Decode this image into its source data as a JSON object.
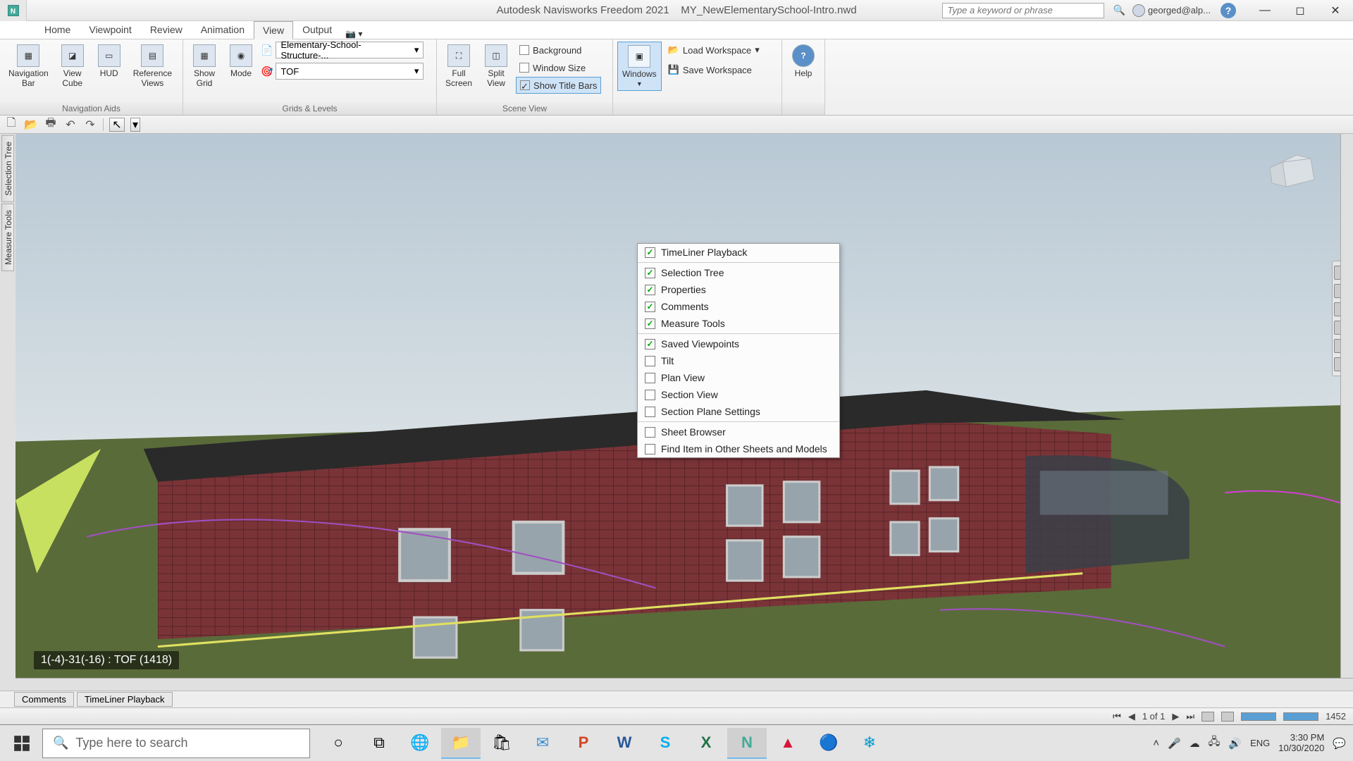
{
  "title": {
    "app": "Autodesk Navisworks Freedom 2021",
    "file": "MY_NewElementarySchool-Intro.nwd"
  },
  "search_placeholder": "Type a keyword or phrase",
  "user_label": "georged@alp...",
  "menu": {
    "tabs": [
      "Home",
      "Viewpoint",
      "Review",
      "Animation",
      "View",
      "Output"
    ],
    "active": "View"
  },
  "ribbon": {
    "nav_aids": {
      "label": "Navigation Aids",
      "navigation_bar": "Navigation\nBar",
      "view_cube": "View\nCube",
      "hud": "HUD",
      "reference_views": "Reference\nViews"
    },
    "grids": {
      "label": "Grids & Levels",
      "show_grid": "Show\nGrid",
      "mode": "Mode",
      "dropdown1": "Elementary-School-Structure-...",
      "dropdown2": "TOF"
    },
    "scene": {
      "label": "Scene View",
      "full_screen": "Full\nScreen",
      "split_view": "Split\nView",
      "background": "Background",
      "window_size": "Window Size",
      "show_title_bars": "Show Title Bars"
    },
    "workspace": {
      "windows": "Windows",
      "load": "Load Workspace",
      "save": "Save Workspace"
    },
    "help": "Help"
  },
  "windows_menu": [
    {
      "label": "TimeLiner Playback",
      "checked": true
    },
    {
      "sep": true
    },
    {
      "label": "Selection Tree",
      "checked": true
    },
    {
      "label": "Properties",
      "checked": true
    },
    {
      "label": "Comments",
      "checked": true
    },
    {
      "label": "Measure Tools",
      "checked": true
    },
    {
      "sep": true
    },
    {
      "label": "Saved Viewpoints",
      "checked": true
    },
    {
      "label": "Tilt",
      "checked": false
    },
    {
      "label": "Plan View",
      "checked": false
    },
    {
      "label": "Section View",
      "checked": false
    },
    {
      "label": "Section Plane Settings",
      "checked": false
    },
    {
      "sep": true
    },
    {
      "label": "Sheet Browser",
      "checked": false
    },
    {
      "label": "Find Item in Other Sheets and Models",
      "checked": false
    }
  ],
  "side_tabs": [
    "Selection Tree",
    "Measure Tools"
  ],
  "coord_overlay": "1(-4)-31(-16) : TOF (1418)",
  "bottom_tabs": [
    "Comments",
    "TimeLiner Playback"
  ],
  "status": {
    "page": "1 of 1",
    "count": "1452"
  },
  "taskbar": {
    "search_placeholder": "Type here to search"
  },
  "tray": {
    "lang": "ENG",
    "time": "3:30 PM",
    "date": "10/30/2020"
  }
}
